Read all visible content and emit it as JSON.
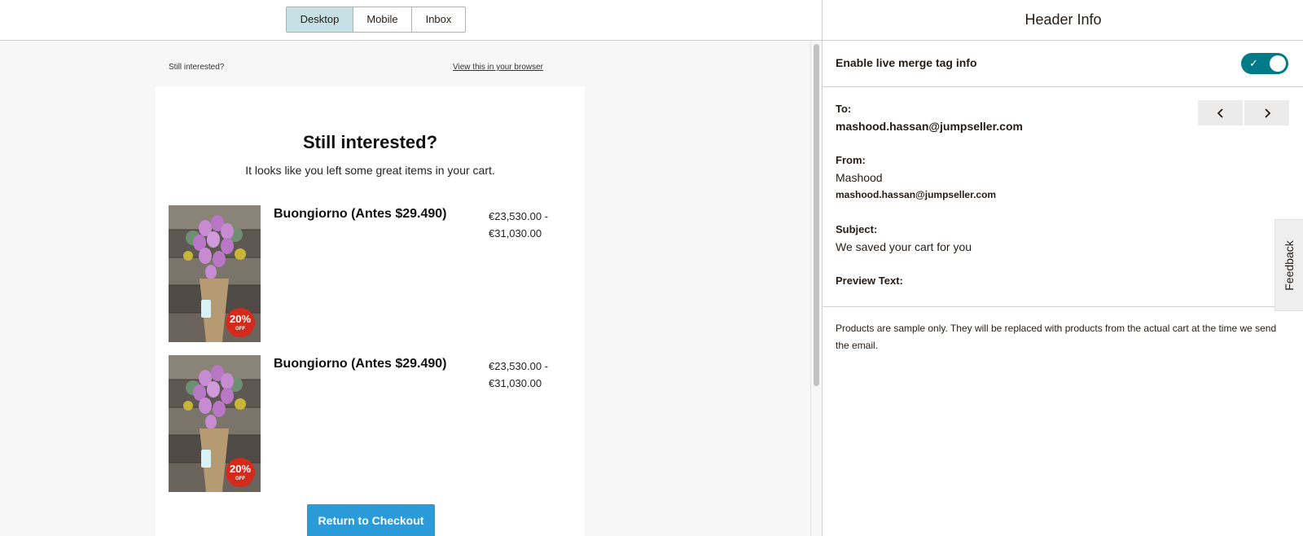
{
  "view_tabs": [
    {
      "label": "Desktop",
      "active": true
    },
    {
      "label": "Mobile",
      "active": false
    },
    {
      "label": "Inbox",
      "active": false
    }
  ],
  "email": {
    "preheader_text": "Still interested?",
    "view_in_browser": "View this in your browser",
    "title": "Still interested?",
    "subtitle": "It looks like you left some great items in your cart.",
    "products": [
      {
        "name": "Buongiorno (Antes $29.490)",
        "price_line1": "€23,530.00 -",
        "price_line2": "€31,030.00",
        "badge_pct": "20%",
        "badge_off": "OFF"
      },
      {
        "name": "Buongiorno (Antes $29.490)",
        "price_line1": "€23,530.00 -",
        "price_line2": "€31,030.00",
        "badge_pct": "20%",
        "badge_off": "OFF"
      }
    ],
    "checkout_button": "Return to Checkout",
    "button_color": "#2a9ad8"
  },
  "panel": {
    "title": "Header Info",
    "toggle_label": "Enable live merge tag info",
    "toggle_on": true,
    "accent_color": "#007c89",
    "to_label": "To:",
    "to_value": "mashood.hassan@jumpseller.com",
    "from_label": "From:",
    "from_name": "Mashood",
    "from_email": "mashood.hassan@jumpseller.com",
    "subject_label": "Subject:",
    "subject_value": "We saved your cart for you",
    "preview_label": "Preview Text:",
    "note": "Products are sample only. They will be replaced with products from the actual cart at the time we send the email.",
    "pager_prev_icon": "chevron-left-icon",
    "pager_next_icon": "chevron-right-icon"
  },
  "feedback": {
    "label": "Feedback"
  }
}
